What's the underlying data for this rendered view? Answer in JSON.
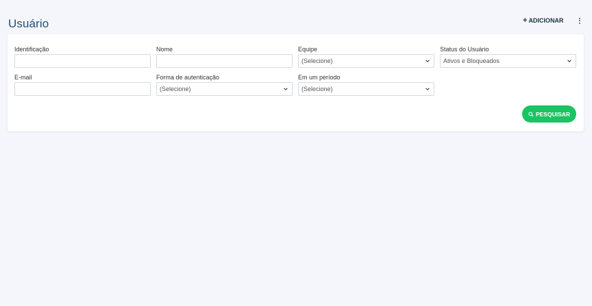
{
  "header": {
    "title": "Usuário",
    "add_label": "ADICIONAR",
    "add_icon": "plus-icon",
    "menu_icon": "kebab-icon"
  },
  "form": {
    "identificacao": {
      "label": "Identificação",
      "value": ""
    },
    "nome": {
      "label": "Nome",
      "value": ""
    },
    "equipe": {
      "label": "Equipe",
      "selected": "(Selecione)"
    },
    "status": {
      "label": "Status do Usuário",
      "selected": "Ativos e Bloqueados"
    },
    "email": {
      "label": "E-mail",
      "value": ""
    },
    "autenticacao": {
      "label": "Forma de autenticação",
      "selected": "(Selecione)"
    },
    "periodo": {
      "label": "Em um período",
      "selected": "(Selecione)"
    },
    "search_label": "PESQUISAR",
    "search_icon": "search-icon"
  },
  "colors": {
    "title": "#1f4e79",
    "background": "#f4f6fb",
    "search_button": "#19c462"
  }
}
